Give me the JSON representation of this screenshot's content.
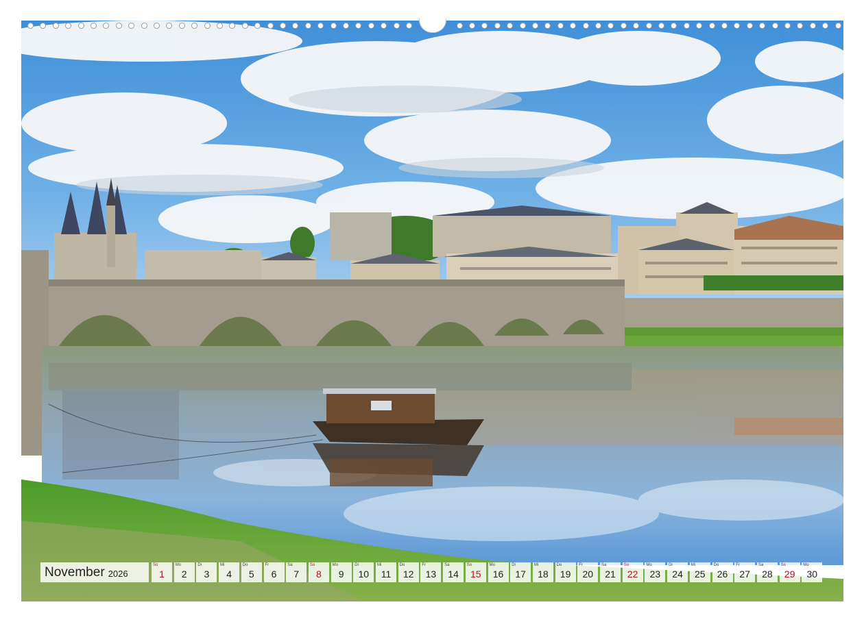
{
  "calendar": {
    "month": "November",
    "year": "2026",
    "days": [
      {
        "wd": "So",
        "d": "1",
        "sunday": true
      },
      {
        "wd": "Mo",
        "d": "2",
        "sunday": false
      },
      {
        "wd": "Di",
        "d": "3",
        "sunday": false
      },
      {
        "wd": "Mi",
        "d": "4",
        "sunday": false
      },
      {
        "wd": "Do",
        "d": "5",
        "sunday": false
      },
      {
        "wd": "Fr",
        "d": "6",
        "sunday": false
      },
      {
        "wd": "Sa",
        "d": "7",
        "sunday": false
      },
      {
        "wd": "So",
        "d": "8",
        "sunday": true
      },
      {
        "wd": "Mo",
        "d": "9",
        "sunday": false
      },
      {
        "wd": "Di",
        "d": "10",
        "sunday": false
      },
      {
        "wd": "Mi",
        "d": "11",
        "sunday": false
      },
      {
        "wd": "Do",
        "d": "12",
        "sunday": false
      },
      {
        "wd": "Fr",
        "d": "13",
        "sunday": false
      },
      {
        "wd": "Sa",
        "d": "14",
        "sunday": false
      },
      {
        "wd": "So",
        "d": "15",
        "sunday": true
      },
      {
        "wd": "Mo",
        "d": "16",
        "sunday": false
      },
      {
        "wd": "Di",
        "d": "17",
        "sunday": false
      },
      {
        "wd": "Mi",
        "d": "18",
        "sunday": false
      },
      {
        "wd": "Do",
        "d": "19",
        "sunday": false
      },
      {
        "wd": "Fr",
        "d": "20",
        "sunday": false
      },
      {
        "wd": "Sa",
        "d": "21",
        "sunday": false
      },
      {
        "wd": "So",
        "d": "22",
        "sunday": true
      },
      {
        "wd": "Mo",
        "d": "23",
        "sunday": false
      },
      {
        "wd": "Di",
        "d": "24",
        "sunday": false
      },
      {
        "wd": "Mi",
        "d": "25",
        "sunday": false
      },
      {
        "wd": "Do",
        "d": "26",
        "sunday": false
      },
      {
        "wd": "Fr",
        "d": "27",
        "sunday": false
      },
      {
        "wd": "Sa",
        "d": "28",
        "sunday": false
      },
      {
        "wd": "So",
        "d": "29",
        "sunday": true
      },
      {
        "wd": "Mo",
        "d": "30",
        "sunday": false
      }
    ]
  },
  "colors": {
    "sunday": "#b3121c",
    "weekday": "#222222"
  },
  "photo": {
    "subject": "landscape-photo"
  }
}
